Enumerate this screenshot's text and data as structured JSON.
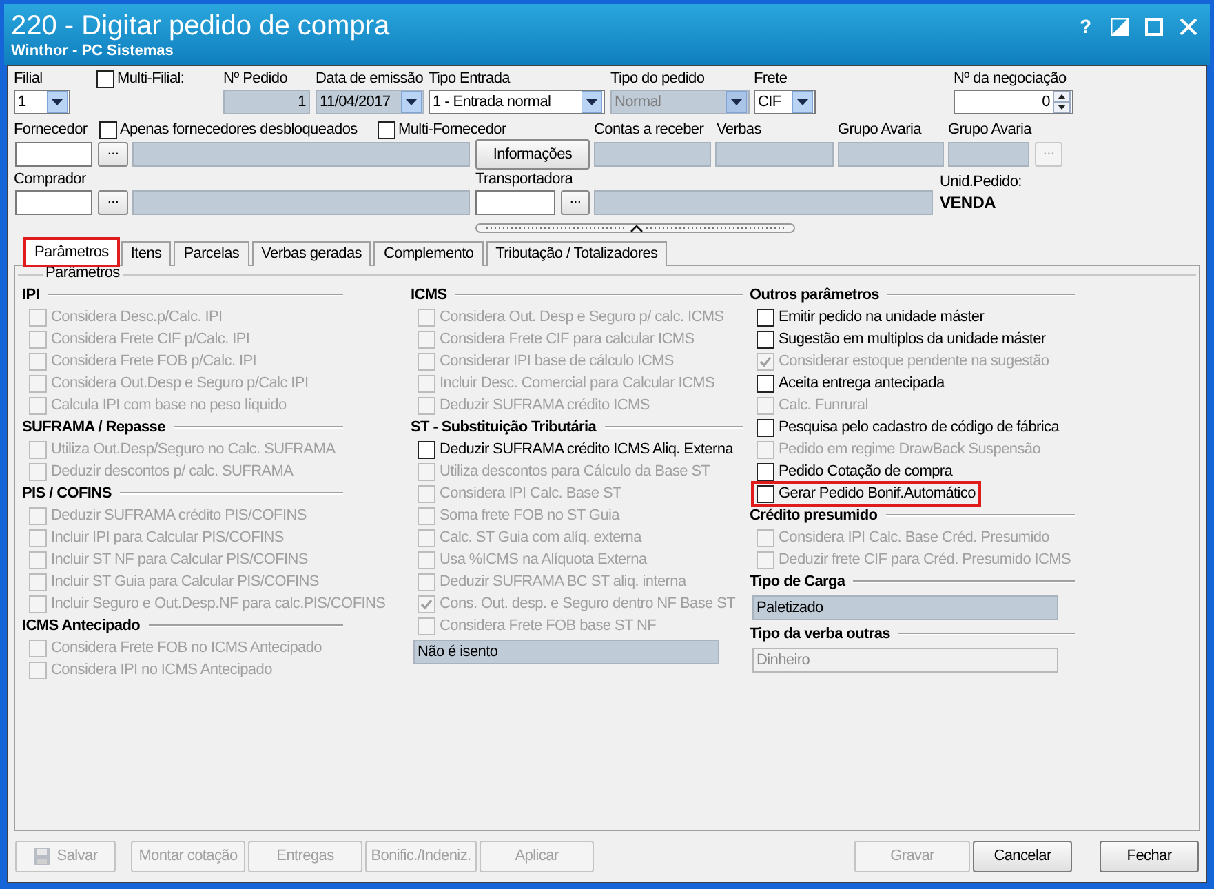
{
  "window": {
    "title": "220 - Digitar pedido de compra",
    "subtitle": "Winthor - PC Sistemas"
  },
  "window_controls": [
    {
      "kind": "help",
      "label": "?"
    },
    {
      "kind": "theme"
    },
    {
      "kind": "maximize"
    },
    {
      "kind": "close"
    }
  ],
  "header": {
    "filial": {
      "label": "Filial",
      "value": "1",
      "readonly": false,
      "disabled": false
    },
    "multi_filial": {
      "label": "Multi-Filial:",
      "checked": false
    },
    "numero_pedido": {
      "label": "Nº Pedido",
      "value": "1",
      "readonly": true,
      "disabled": false
    },
    "data_emissao": {
      "label": "Data de emissão",
      "value": "11/04/2017",
      "readonly": true,
      "disabled": false
    },
    "tipo_entrada": {
      "label": "Tipo Entrada",
      "value": "1 - Entrada normal",
      "readonly": false,
      "disabled": false
    },
    "tipo_pedido": {
      "label": "Tipo do pedido",
      "value": "Normal",
      "readonly": true,
      "disabled": true
    },
    "frete": {
      "label": "Frete",
      "value": "CIF",
      "readonly": false,
      "disabled": false
    },
    "negociacao": {
      "label": "Nº da negociação",
      "value": "0",
      "readonly": false,
      "disabled": false
    },
    "fornecedor": {
      "label": "Fornecedor",
      "browse_label": "..."
    },
    "fornecedor_options": [
      {
        "label": "Apenas fornecedores desbloqueados",
        "checked": false
      },
      {
        "label": "Multi-Fornecedor",
        "checked": false
      }
    ],
    "informacoes_button": "Informações",
    "summary_fields": [
      {
        "label": "Contas a receber"
      },
      {
        "label": "Verbas"
      },
      {
        "label": "Grupo Avaria"
      },
      {
        "label": "Grupo Avaria",
        "browse_label": "..."
      }
    ],
    "comprador": {
      "label": "Comprador",
      "browse_label": "..."
    },
    "transportadora": {
      "label": "Transportadora",
      "browse_label": "..."
    },
    "unid_pedido": {
      "label": "Unid.Pedido:",
      "value": "VENDA"
    }
  },
  "tabs": [
    {
      "label": "Parâmetros",
      "selected": true,
      "highlighted": true
    },
    {
      "label": "Itens",
      "selected": false,
      "highlighted": false
    },
    {
      "label": "Parcelas",
      "selected": false,
      "highlighted": false
    },
    {
      "label": "Verbas geradas",
      "selected": false,
      "highlighted": false
    },
    {
      "label": "Complemento",
      "selected": false,
      "highlighted": false
    },
    {
      "label": "Tributação / Totalizadores",
      "selected": false,
      "highlighted": false
    }
  ],
  "group_title": "Parâmetros",
  "columns": [
    {
      "sections": [
        {
          "title": "IPI",
          "items": [
            {
              "label": "Considera Desc.p/Calc. IPI",
              "checked": false,
              "disabled": true
            },
            {
              "label": "Considera Frete CIF p/Calc. IPI",
              "checked": false,
              "disabled": true
            },
            {
              "label": "Considera Frete FOB p/Calc. IPI",
              "checked": false,
              "disabled": true
            },
            {
              "label": "Considera Out.Desp e Seguro p/Calc IPI",
              "checked": false,
              "disabled": true
            },
            {
              "label": "Calcula IPI com base no peso líquido",
              "checked": false,
              "disabled": true
            }
          ]
        },
        {
          "title": "SUFRAMA / Repasse",
          "items": [
            {
              "label": "Utiliza Out.Desp/Seguro no Calc. SUFRAMA",
              "checked": false,
              "disabled": true
            },
            {
              "label": "Deduzir descontos p/ calc. SUFRAMA",
              "checked": false,
              "disabled": true
            }
          ]
        },
        {
          "title": "PIS / COFINS",
          "items": [
            {
              "label": "Deduzir SUFRAMA crédito PIS/COFINS",
              "checked": false,
              "disabled": true
            },
            {
              "label": "Incluir IPI para Calcular PIS/COFINS",
              "checked": false,
              "disabled": true
            },
            {
              "label": "Incluir ST NF para Calcular PIS/COFINS",
              "checked": false,
              "disabled": true
            },
            {
              "label": "Incluir ST Guia para Calcular PIS/COFINS",
              "checked": false,
              "disabled": true
            },
            {
              "label": "Incluir Seguro e Out.Desp.NF para calc.PIS/COFINS",
              "checked": false,
              "disabled": true
            }
          ]
        },
        {
          "title": "ICMS Antecipado",
          "items": [
            {
              "label": "Considera Frete FOB no ICMS Antecipado",
              "checked": false,
              "disabled": true
            },
            {
              "label": "Considera IPI no ICMS Antecipado",
              "checked": false,
              "disabled": true
            }
          ]
        }
      ]
    },
    {
      "sections": [
        {
          "title": "ICMS",
          "items": [
            {
              "label": "Considera Out. Desp e Seguro p/ calc. ICMS",
              "checked": false,
              "disabled": true
            },
            {
              "label": "Considera Frete CIF para calcular ICMS",
              "checked": false,
              "disabled": true
            },
            {
              "label": "Considerar IPI base de cálculo ICMS",
              "checked": false,
              "disabled": true
            },
            {
              "label": "Incluir Desc. Comercial  para Calcular ICMS",
              "checked": false,
              "disabled": true
            },
            {
              "label": "Deduzir SUFRAMA crédito ICMS",
              "checked": false,
              "disabled": true
            }
          ]
        },
        {
          "title": "ST - Substituição Tributária",
          "items": [
            {
              "label": "Deduzir SUFRAMA crédito ICMS Aliq. Externa",
              "checked": false,
              "disabled": false
            },
            {
              "label": "Utiliza descontos para Cálculo da Base ST",
              "checked": false,
              "disabled": true
            },
            {
              "label": "Considera IPI Calc. Base ST",
              "checked": false,
              "disabled": true
            },
            {
              "label": "Soma frete FOB no ST Guia",
              "checked": false,
              "disabled": true
            },
            {
              "label": "Calc. ST Guia com alíq. externa",
              "checked": false,
              "disabled": true
            },
            {
              "label": "Usa %ICMS na Alíquota Externa",
              "checked": false,
              "disabled": true
            },
            {
              "label": "Deduzir SUFRAMA BC ST aliq. interna",
              "checked": false,
              "disabled": true
            },
            {
              "label": "Cons. Out. desp. e Seguro dentro NF Base ST",
              "checked": true,
              "disabled": true
            },
            {
              "label": "Considera Frete FOB base ST NF",
              "checked": false,
              "disabled": true
            }
          ],
          "field": {
            "value": "Não é isento",
            "readonly": true,
            "disabled": false
          }
        }
      ]
    },
    {
      "sections": [
        {
          "title": "Outros parâmetros",
          "items": [
            {
              "label": "Emitir pedido na unidade máster",
              "checked": false,
              "disabled": false
            },
            {
              "label": "Sugestão em multiplos da unidade máster",
              "checked": false,
              "disabled": false
            },
            {
              "label": "Considerar estoque pendente na sugestão",
              "checked": true,
              "disabled": true
            },
            {
              "label": "Aceita entrega antecipada",
              "checked": false,
              "disabled": false
            },
            {
              "label": "Calc. Funrural",
              "checked": false,
              "disabled": true
            },
            {
              "label": "Pesquisa pelo cadastro de código de fábrica",
              "checked": false,
              "disabled": false
            },
            {
              "label": "Pedido em regime DrawBack Suspensão",
              "checked": false,
              "disabled": true
            },
            {
              "label": "Pedido Cotação de compra",
              "checked": false,
              "disabled": false
            },
            {
              "label": "Gerar Pedido Bonif.Automático",
              "checked": false,
              "disabled": false,
              "highlighted": true
            }
          ]
        },
        {
          "title": "Crédito presumido",
          "items": [
            {
              "label": "Considera IPI Calc. Base Créd. Presumido",
              "checked": false,
              "disabled": true
            },
            {
              "label": "Deduzir frete CIF para Créd. Presumido ICMS",
              "checked": false,
              "disabled": true
            }
          ]
        },
        {
          "title": "Tipo de Carga",
          "field": {
            "value": "Paletizado",
            "readonly": true,
            "disabled": false
          }
        },
        {
          "title": "Tipo da verba outras",
          "field": {
            "value": "Dinheiro",
            "readonly": false,
            "disabled": true
          }
        }
      ]
    }
  ],
  "left_buttons": [
    {
      "label": "Salvar",
      "kind": "save",
      "disabled": true
    },
    {
      "label": "Montar cotação",
      "disabled": true
    },
    {
      "label": "Entregas",
      "disabled": true
    },
    {
      "label": "Bonific./Indeniz.",
      "disabled": true
    },
    {
      "label": "Aplicar",
      "disabled": true
    }
  ],
  "right_buttons": [
    {
      "label": "Gravar",
      "disabled": true
    },
    {
      "label": "Cancelar",
      "disabled": false
    },
    {
      "label": "Fechar",
      "disabled": false
    }
  ]
}
